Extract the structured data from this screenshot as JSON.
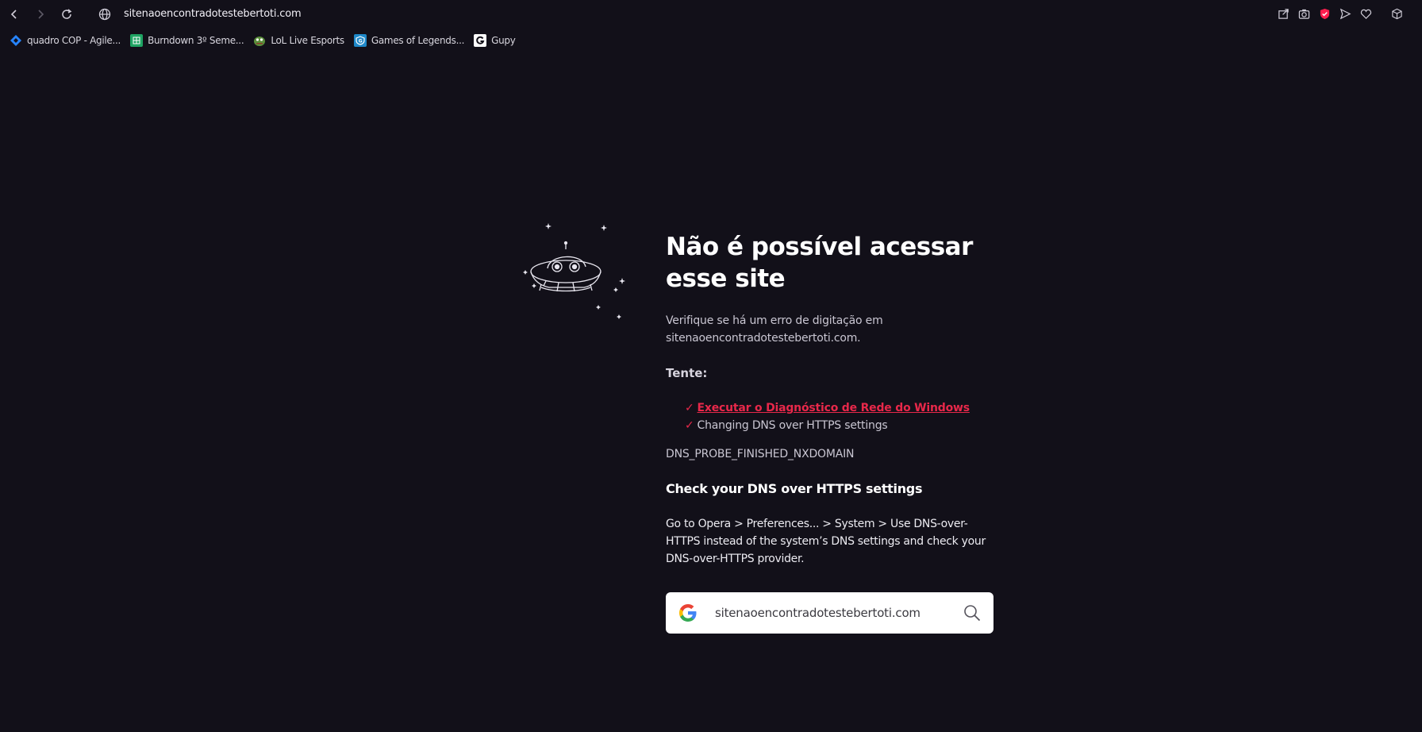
{
  "toolbar": {
    "url": "sitenaoencontradotestebertoti.com",
    "back_icon": "chevron-left-icon",
    "forward_icon": "chevron-right-icon",
    "reload_icon": "reload-icon",
    "site_icon": "globe-icon",
    "tools": [
      "share-icon",
      "camera-icon",
      "shield-icon",
      "send-icon",
      "heart-icon",
      "cube-icon"
    ]
  },
  "bookmarks": [
    {
      "label": "quadro COP - Agile...",
      "icon": "jira-icon",
      "color": "#2684ff"
    },
    {
      "label": "Burndown 3º Seme...",
      "icon": "sheets-icon",
      "color": "#1fa463"
    },
    {
      "label": "LoL Live Esports",
      "icon": "pepe-icon",
      "color": "#5a8f3b"
    },
    {
      "label": "Games of Legends...",
      "icon": "gol-icon",
      "color": "#1e88c8"
    },
    {
      "label": "Gupy",
      "icon": "gupy-icon",
      "color": "#ffffff"
    }
  ],
  "error": {
    "title": "Não é possível acessar esse site",
    "desc_line1": "Verifique se há um erro de digitação em",
    "desc_line2": "sitenaoencontradotestebertoti.com.",
    "try_label": "Tente:",
    "try_items": [
      {
        "check": "✓",
        "text": "Executar o Diagnóstico de Rede do Windows",
        "link": true
      },
      {
        "check": "✓",
        "text": "Changing DNS over HTTPS settings",
        "link": false
      }
    ],
    "code": "DNS_PROBE_FINISHED_NXDOMAIN",
    "dns_title": "Check your DNS over HTTPS settings",
    "dns_desc": "Go to Opera > Preferences... > System > Use DNS-over-HTTPS instead of the system’s DNS settings and check your DNS-over-HTTPS provider."
  },
  "search": {
    "value": "sitenaoencontradotestebertoti.com",
    "icon": "search-icon",
    "engine_icon": "google-icon"
  },
  "colors": {
    "background": "#121019",
    "accent": "#e8284a"
  }
}
